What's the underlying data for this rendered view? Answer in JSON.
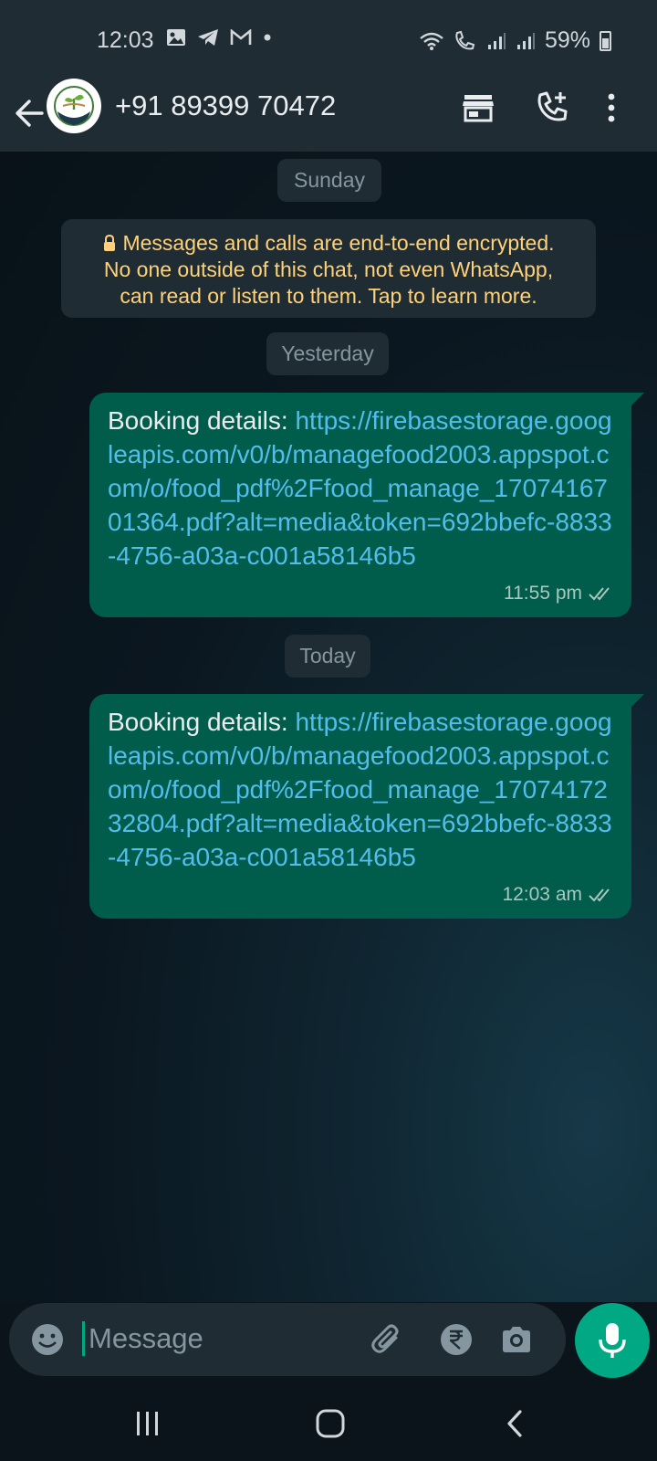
{
  "status_bar": {
    "time": "12:03",
    "battery_percent": "59%",
    "battery_level": 0.59,
    "left_icons": [
      "gallery-icon",
      "telegram-icon",
      "gmail-icon",
      "dot-icon"
    ],
    "right_icons": [
      "wifi-icon",
      "volte-call-icon",
      "signal-icon",
      "signal-icon",
      "battery-icon"
    ]
  },
  "header": {
    "contact": "+91 89399 70472",
    "icons": [
      "back-arrow-icon",
      "store-icon",
      "add-call-icon",
      "more-vert-icon"
    ]
  },
  "chat": {
    "date_sunday": "Sunday",
    "encryption_notice": {
      "line1": "Messages and calls are end-to-end encrypted.",
      "line2": "No one outside of this chat, not even WhatsApp,",
      "line3": "can read or listen to them. Tap to learn more."
    },
    "date_yesterday": "Yesterday",
    "date_today": "Today",
    "messages": [
      {
        "prefix": "Booking details: ",
        "link": "https://firebasestorage.googleapis.com/v0/b/managefood2003.appspot.com/o/food_pdf%2Ffood_manage_1707416701364.pdf?alt=media&token=692bbefc-8833-4756-a03a-c001a58146b5",
        "time": "11:55 pm",
        "status": "read-double-tick-icon"
      },
      {
        "prefix": "Booking details: ",
        "link": "https://firebasestorage.googleapis.com/v0/b/managefood2003.appspot.com/o/food_pdf%2Ffood_manage_1707417232804.pdf?alt=media&token=692bbefc-8833-4756-a03a-c001a58146b5",
        "time": "12:03 am",
        "status": "read-double-tick-icon"
      }
    ]
  },
  "composer": {
    "placeholder": "Message",
    "icons": [
      "emoji-icon",
      "attach-icon",
      "rupee-payment-icon",
      "camera-icon",
      "mic-icon"
    ]
  },
  "colors": {
    "accent": "#00a884",
    "outgoing_bubble": "#005c4b",
    "link": "#53bdeb",
    "encryption_text": "#ffd279"
  }
}
